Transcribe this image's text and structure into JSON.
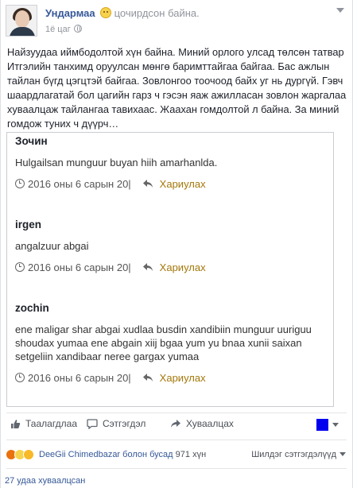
{
  "header": {
    "author_name": "Ундармаа",
    "feeling_icon": "smiling-face-icon",
    "feeling_text": "цочирдсон байна.",
    "time": "1ё цаг",
    "privacy_icon": "globe-icon"
  },
  "post": {
    "text": "Найзуудаа иймбодолтой хүн байна. Миний орлого улсад төлсөн татвар Итгэлийн танхимд оруулсан мөнгө баримттайгаа байгаа. Бас ажлын тайлан бүгд цэгцтэй байгаа. Зовлонгоо тоочоод байх уг нь дургүй. Гэвч шаардлагатай бол цагийн гарз ч гэсэн яаж ажилласан зовлон жаргалаа хуваалцаж тайлангаа тавихаас. Жаахан гомдолтой л байна. За миний гомдож туних ч дүүрч…"
  },
  "comments": [
    {
      "author": "Зочин",
      "text": "Hulgailsan munguur buyan hiih amarhanlda.",
      "date": "2016 оны 6 сарын 20|",
      "reply_label": "Хариулах"
    },
    {
      "author": "irgen",
      "text": "angalzuur abgai",
      "date": "2016 оны 6 сарын 20|",
      "reply_label": "Хариулах"
    },
    {
      "author": "zochin",
      "text": "ene maligar shar abgai xudlaa busdin xandibiin munguur uuriguu shoudax yumaa ene abgain xiij bgaa yum yu bnaa xunii saixan setgeliin xandibaar neree gargax yumaa",
      "date": "2016 оны 6 сарын 20|",
      "reply_label": "Хариулах"
    }
  ],
  "actions": {
    "like_label": "Таалагдлаа",
    "comment_label": "Сэтгэгдэл",
    "share_label": "Хуваалцах"
  },
  "reactions": {
    "names": "DeeGii Chimedbazar болон бусад",
    "count": "971 хүн",
    "sort_label": "Шилдэг сэтгэгдэлүүд"
  },
  "shares": {
    "label": "27 удаа хуваалцсан"
  },
  "colors": {
    "link": "#365899",
    "reply": "#a4780a",
    "square": "#0000ee"
  }
}
